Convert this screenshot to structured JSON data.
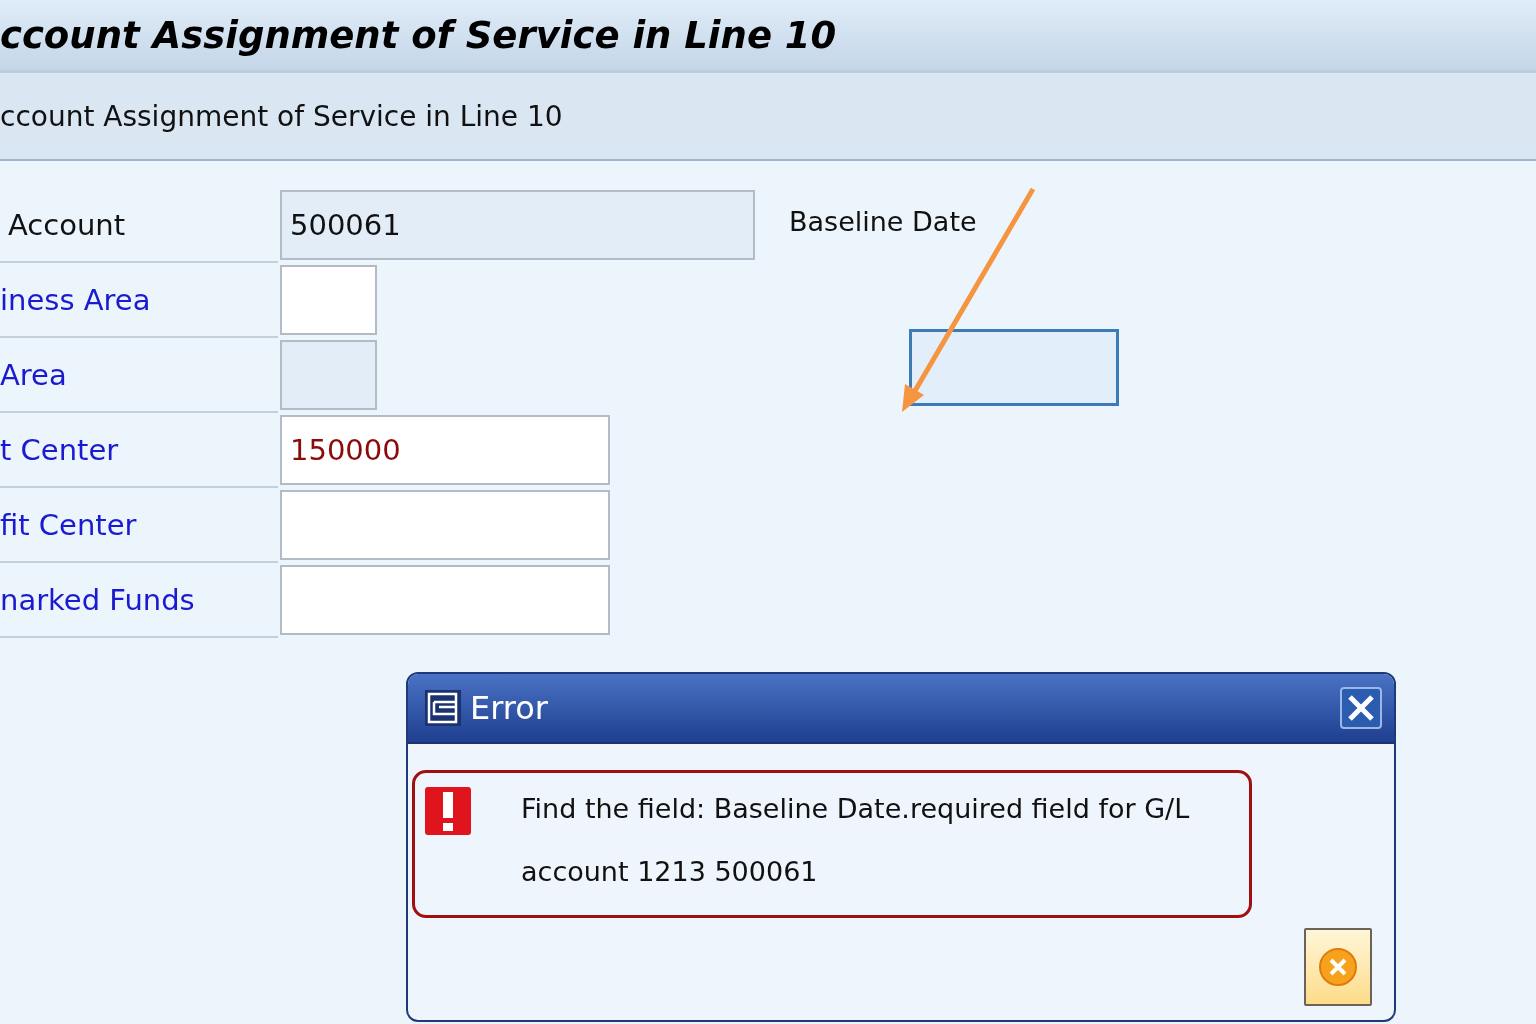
{
  "title_bar": {
    "title": "ccount Assignment of Service in Line 10"
  },
  "section_header": {
    "title": "ccount Assignment of Service in Line 10"
  },
  "fields": [
    {
      "label": "Account",
      "kind": "plain",
      "value": "500061",
      "readonly": true,
      "error": false
    },
    {
      "label": "iness Area",
      "kind": "link",
      "readonly": false
    },
    {
      "label": "Area",
      "kind": "link",
      "readonly": true
    },
    {
      "label": "t Center",
      "kind": "link",
      "value": "150000",
      "readonly": false,
      "error": true
    },
    {
      "label": "fit Center",
      "kind": "link",
      "readonly": false
    },
    {
      "label": "narked Funds",
      "kind": "link",
      "readonly": false
    }
  ],
  "baseline_date": {
    "label": "Baseline Date",
    "focused": true
  },
  "dialog": {
    "title": "Error",
    "message_line_1": "Find the field: Baseline Date.required field for G/L",
    "message_line_2": "account 1213 500061"
  }
}
